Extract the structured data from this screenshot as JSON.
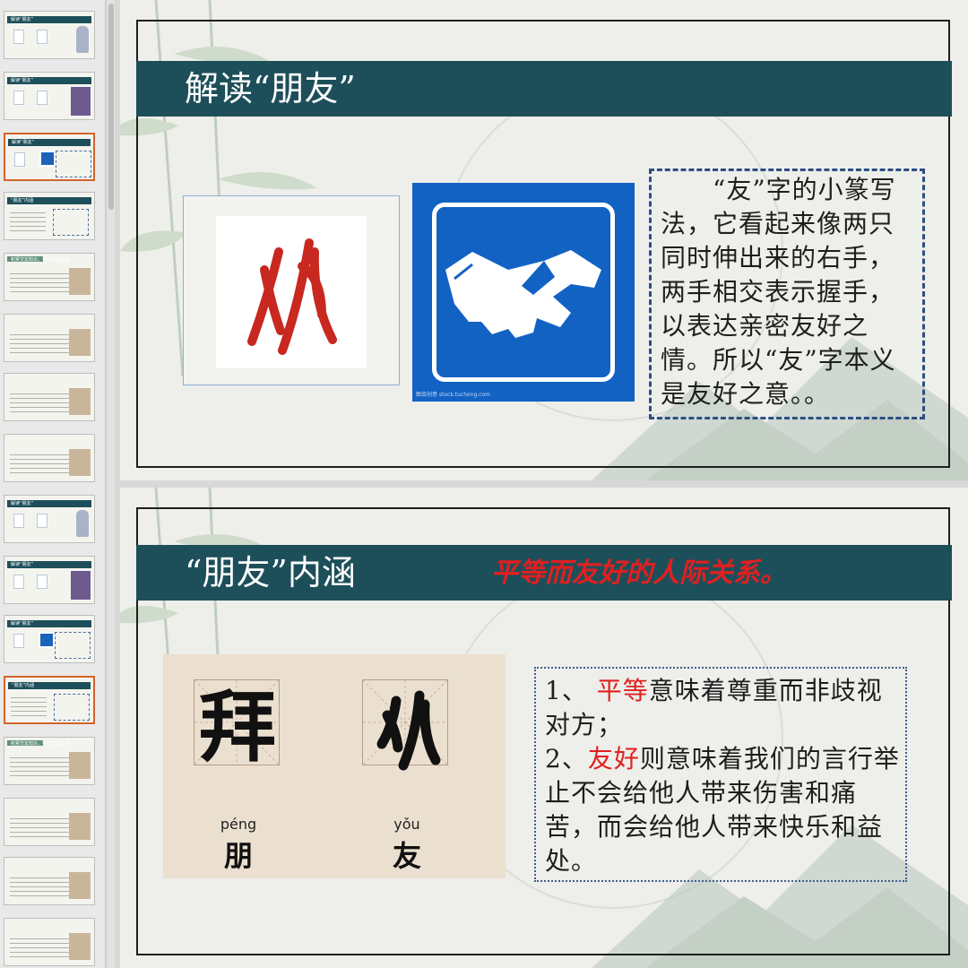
{
  "thumbnails": {
    "items": [
      {
        "title": "解读“朋友”",
        "kind": "glyph-person",
        "selected": false
      },
      {
        "title": "解读“朋友”",
        "kind": "glyph-kids",
        "selected": false
      },
      {
        "title": "解读“朋友”",
        "kind": "glyph-handshake",
        "selected": true
      },
      {
        "title": "“朋友”内涵",
        "kind": "pinyin",
        "selected": false
      },
      {
        "title": "积累交友知识，学习交友之道",
        "kind": "text-pic",
        "selected": false
      },
      {
        "title": "",
        "kind": "text-pic",
        "selected": false
      },
      {
        "title": "",
        "kind": "text-pic",
        "selected": false
      },
      {
        "title": "",
        "kind": "text-pic",
        "selected": false
      },
      {
        "title": "解读“朋友”",
        "kind": "glyph-person",
        "selected": false
      },
      {
        "title": "解读“朋友”",
        "kind": "glyph-kids",
        "selected": false
      },
      {
        "title": "解读“朋友”",
        "kind": "glyph-handshake",
        "selected": false
      },
      {
        "title": "“朋友”内涵",
        "kind": "pinyin",
        "selected": true
      },
      {
        "title": "积累交友知识，学习交友之道",
        "kind": "text-pic",
        "selected": false
      },
      {
        "title": "",
        "kind": "text-pic",
        "selected": false
      },
      {
        "title": "",
        "kind": "text-pic",
        "selected": false
      },
      {
        "title": "",
        "kind": "text-pic",
        "selected": false
      }
    ]
  },
  "slide1": {
    "title": "解读“朋友”",
    "seal_glyph": "𢪈",
    "watermark": "图虫创意 stock.tuchong.com",
    "explanation": "　　“友”字的小篆写法，它看起来像两只同时伸出来的右手，两手相交表示握手，以表达亲密友好之情。所以“友”字本义是友好之意。。"
  },
  "slide2": {
    "title": "“朋友”内涵",
    "subtitle": "平等而友好的人际关系。",
    "char_peng": {
      "seal": "拜",
      "pinyin": "péng",
      "hanzi": "朋"
    },
    "char_you": {
      "seal": "𢪈",
      "pinyin": "yǒu",
      "hanzi": "友"
    },
    "point1": {
      "prefix": "1、 ",
      "keyword": "平等",
      "rest": "意味着尊重而非歧视对方；"
    },
    "point2": {
      "prefix": "2、",
      "keyword": "友好",
      "rest": "则意味着我们的言行举止不会给他人带来伤害和痛苦，而会给他人带来快乐和益处。"
    }
  },
  "colors": {
    "title_bar": "#1d4f5a",
    "accent_red": "#e02020",
    "handshake_blue": "#1262c4",
    "dash_border": "#2c4f83"
  }
}
